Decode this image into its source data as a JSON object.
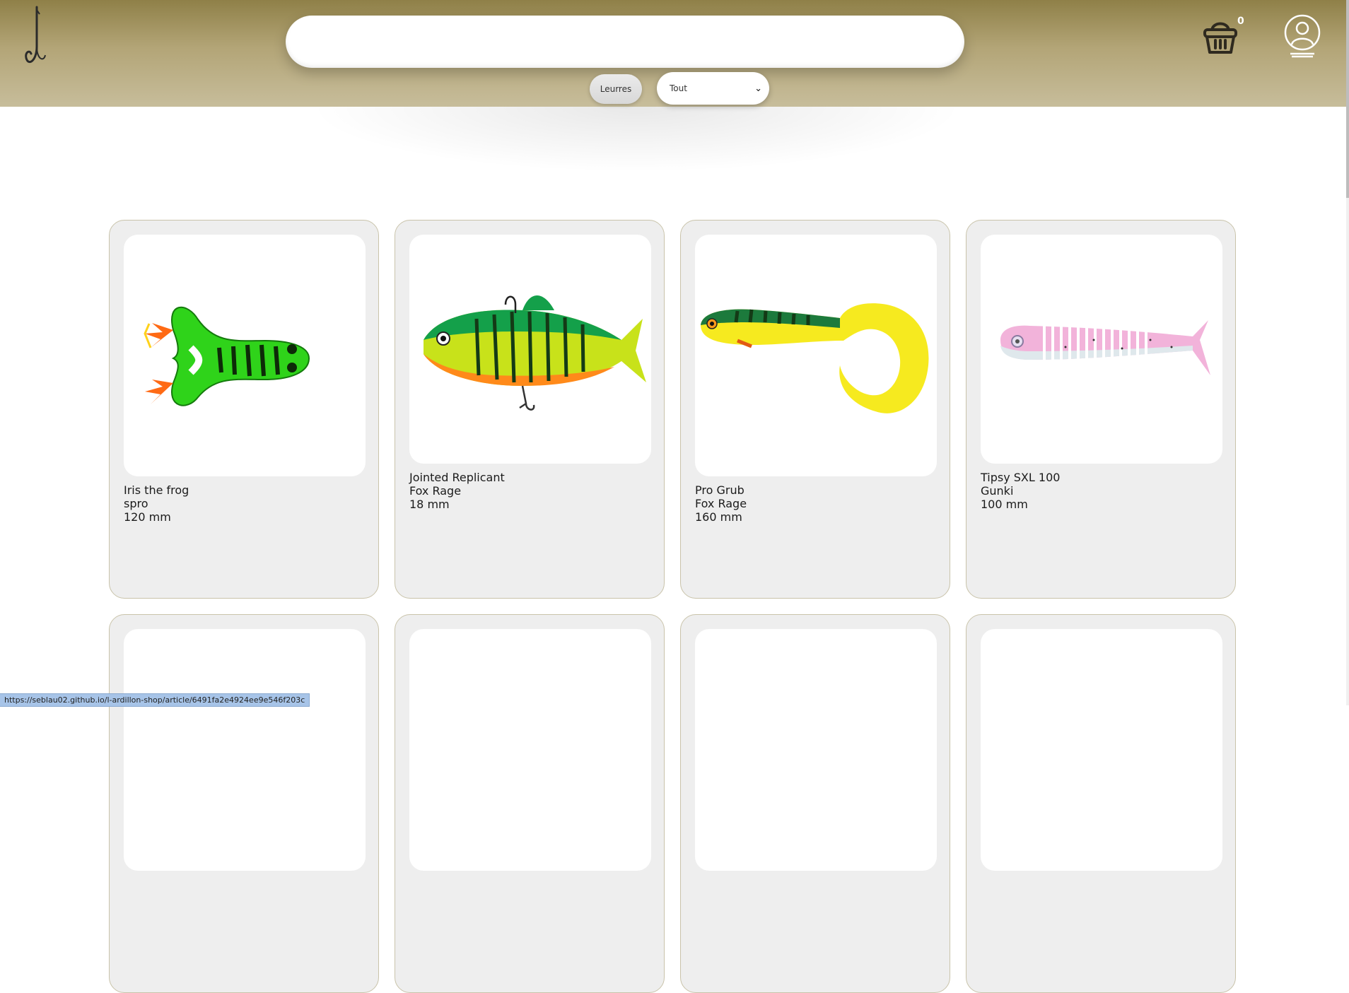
{
  "header": {
    "search_value": "",
    "category_button": "Leurres",
    "filter_selected": "Tout",
    "cart_count": "0",
    "colors": {
      "header_top": "#8f8048",
      "header_bottom": "#c7bd9b"
    }
  },
  "icons": [
    "hook-logo-icon",
    "basket-icon",
    "user-account-icon",
    "chevron-down-icon"
  ],
  "products": [
    {
      "name": "Iris the frog",
      "brand": "spro",
      "size": "120 mm"
    },
    {
      "name": "Jointed Replicant",
      "brand": "Fox Rage",
      "size": "18 mm"
    },
    {
      "name": "Pro Grub",
      "brand": "Fox Rage",
      "size": "160 mm"
    },
    {
      "name": "Tipsy SXL 100",
      "brand": "Gunki",
      "size": "100 mm"
    }
  ],
  "status_bar": {
    "url": "https://seblau02.github.io/l-ardillon-shop/article/6491fa2e4924ee9e546f203c"
  }
}
